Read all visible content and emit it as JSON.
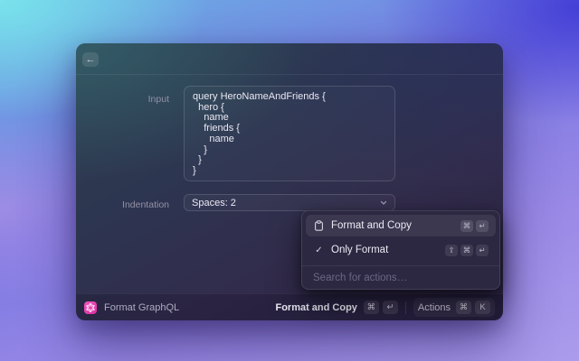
{
  "colors": {
    "accent_pink": "#DD2EA2",
    "desktop_top_left": "#7AE5EC",
    "desktop_top_right": "#423CD6",
    "desktop_bottom": "#AB9CEC",
    "panel_bg": "#2C2842",
    "selected_row_bg": "#3A3553"
  },
  "icons": {
    "back": "←",
    "check": "✓"
  },
  "window": {
    "form": {
      "input_label": "Input",
      "input_value": "query HeroNameAndFriends {\n  hero {\n    name\n    friends {\n      name\n    }\n  }\n}",
      "indentation_label": "Indentation",
      "indentation_value": "Spaces: 2"
    },
    "statusbar": {
      "app_name": "Format GraphQL",
      "primary_action_label": "Format and Copy",
      "primary_action_keys": [
        "⌘",
        "↵"
      ],
      "actions_button_label": "Actions",
      "actions_button_keys": [
        "⌘",
        "K"
      ]
    }
  },
  "actions_panel": {
    "items": [
      {
        "label": "Format and Copy",
        "icon": "clipboard",
        "keys": [
          "⌘",
          "↵"
        ],
        "selected": true
      },
      {
        "label": "Only Format",
        "icon": "check",
        "keys": [
          "⇧",
          "⌘",
          "↵"
        ],
        "selected": false
      }
    ],
    "search_placeholder": "Search for actions…"
  }
}
